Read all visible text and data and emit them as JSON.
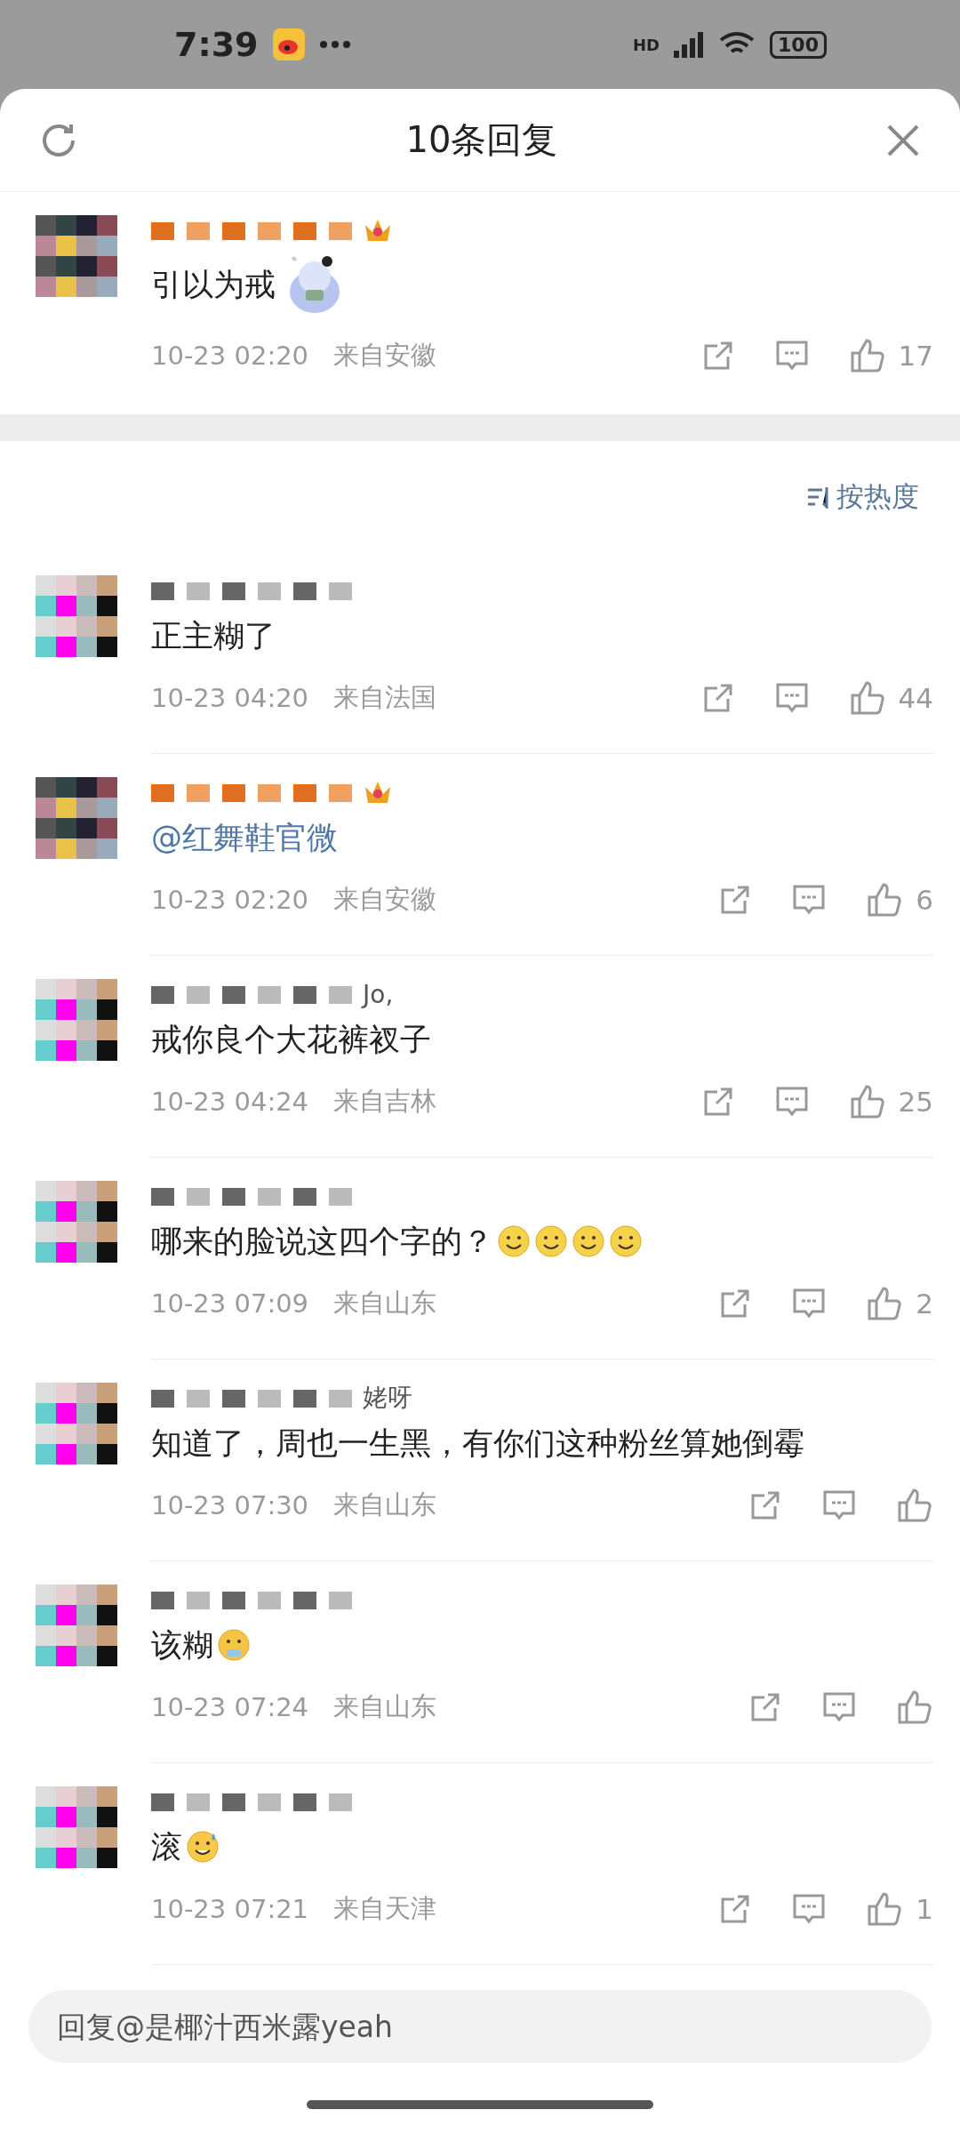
{
  "status_bar": {
    "time": "7:39",
    "network": "HD",
    "battery": "100"
  },
  "header": {
    "title": "10条回复"
  },
  "parent_comment": {
    "vip": true,
    "text": "引以为戒",
    "sticker": true,
    "time": "10-23 02:20",
    "location": "来自安徽",
    "likes": "17"
  },
  "sort": {
    "label": "按热度"
  },
  "comments": [
    {
      "vip": false,
      "text": "正主糊了",
      "time": "10-23 04:20",
      "location": "来自法国",
      "likes": "44"
    },
    {
      "vip": true,
      "text": "@红舞鞋官微",
      "kind": "mention",
      "time": "10-23 02:20",
      "location": "来自安徽",
      "likes": "6"
    },
    {
      "vip": false,
      "name": "Jo,",
      "text": "戒你良个大花裤衩子",
      "time": "10-23 04:24",
      "location": "来自吉林",
      "likes": "25"
    },
    {
      "vip": false,
      "text": "哪来的脸说这四个字的？",
      "emojis": [
        {
          "kind": "smile"
        },
        {
          "kind": "smile"
        },
        {
          "kind": "smile"
        },
        {
          "kind": "smile"
        }
      ],
      "time": "10-23 07:09",
      "location": "来自山东",
      "likes": "2"
    },
    {
      "vip": false,
      "name": "姥呀",
      "text": "知道了，周也一生黑，有你们这种粉丝算她倒霉",
      "time": "10-23 07:30",
      "location": "来自山东"
    },
    {
      "vip": false,
      "text": "该糊",
      "emojis": [
        {
          "kind": "steam"
        }
      ],
      "time": "10-23 07:24",
      "location": "来自山东"
    },
    {
      "vip": false,
      "text": "滚",
      "emojis": [
        {
          "kind": "sweat"
        }
      ],
      "time": "10-23 07:21",
      "location": "来自天津",
      "likes": "1"
    }
  ],
  "reply_box": {
    "placeholder": "回复@是椰汁西米露yeah"
  }
}
